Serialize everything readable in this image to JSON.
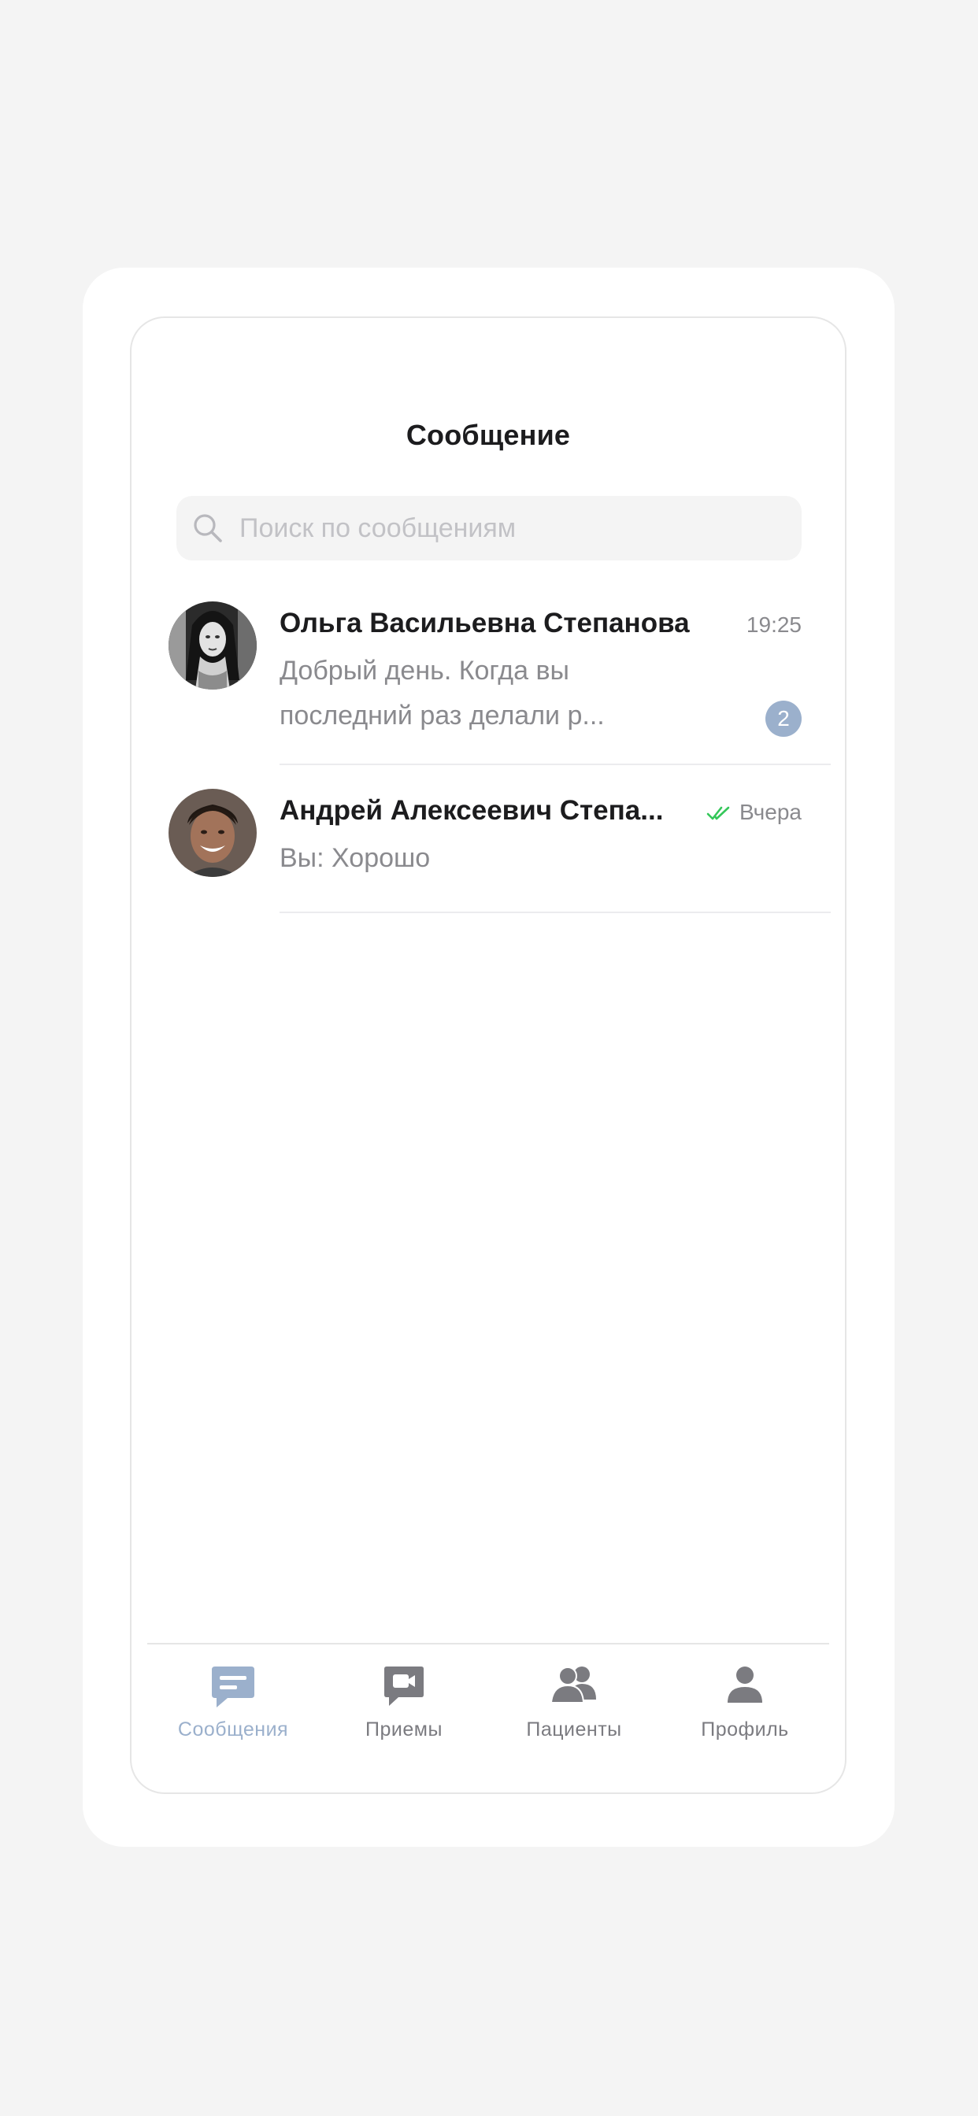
{
  "header": {
    "title": "Сообщение"
  },
  "search": {
    "placeholder": "Поиск по сообщениям",
    "value": ""
  },
  "chats": [
    {
      "name": "Ольга Васильевна Степанова",
      "time": "19:25",
      "preview": "Добрый день. Когда вы последний раз делали р...",
      "unread": "2",
      "avatar": "woman-portrait-bw"
    },
    {
      "name": "Андрей Алексеевич Степа...",
      "time": "Вчера",
      "preview": "Вы: Хорошо",
      "status": "read-double-check-icon",
      "avatar": "man-portrait"
    }
  ],
  "tabbar": {
    "tabs": [
      {
        "label": "Сообщения",
        "icon": "chat-bubble-icon",
        "active": true
      },
      {
        "label": "Приемы",
        "icon": "video-camera-icon",
        "active": false
      },
      {
        "label": "Пациенты",
        "icon": "users-icon",
        "active": false
      },
      {
        "label": "Профиль",
        "icon": "person-icon",
        "active": false
      }
    ]
  },
  "colors": {
    "accent": "#9bb0cc",
    "read_check": "#34c759",
    "text_primary": "#1c1c1e",
    "text_secondary": "#8a8a8e",
    "background": "#f4f4f4"
  }
}
